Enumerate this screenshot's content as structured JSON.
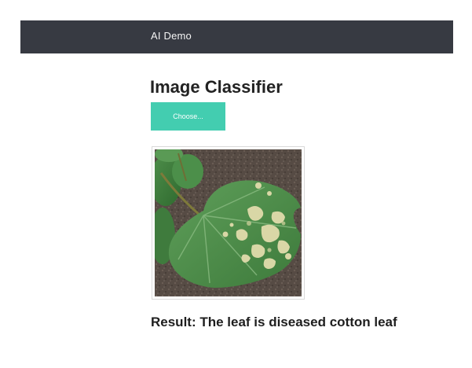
{
  "navbar": {
    "brand": "AI Demo",
    "background": "#373a42"
  },
  "main": {
    "title": "Image Classifier",
    "choose_button": {
      "label": "Choose...",
      "color": "#43cdb0"
    },
    "preview": {
      "subject": "photo of a cotton leaf with light diseased patches on soil background"
    },
    "result": {
      "text": "Result: The leaf is diseased cotton leaf"
    }
  }
}
